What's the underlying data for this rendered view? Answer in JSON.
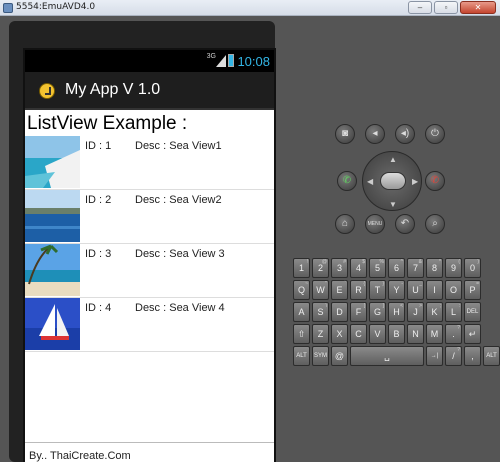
{
  "window": {
    "title": "5554:EmuAVD4.0",
    "buttons": [
      "‒",
      "▫",
      "✕"
    ]
  },
  "status": {
    "network": "3G",
    "time": "10:08"
  },
  "app": {
    "title": "My App V 1.0"
  },
  "list": {
    "header": "ListView Example :",
    "items": [
      {
        "id": "ID : 1",
        "desc": "Desc : Sea View1",
        "image": "sea-view-1"
      },
      {
        "id": "ID : 2",
        "desc": "Desc : Sea View2",
        "image": "sea-view-2"
      },
      {
        "id": "ID : 3",
        "desc": "Desc : Sea View 3",
        "image": "sea-view-3"
      },
      {
        "id": "ID : 4",
        "desc": "Desc : Sea View 4",
        "image": "sea-view-4"
      }
    ]
  },
  "footer": {
    "text": "By.. ThaiCreate.Com"
  },
  "controls": {
    "top_row": [
      "camera-icon",
      "volume-down-icon",
      "volume-up-icon",
      "power-icon"
    ],
    "call_buttons": [
      "call-icon",
      "end-call-icon"
    ],
    "bottom_row": [
      "home-icon",
      "menu-button",
      "back-icon",
      "search-icon"
    ],
    "menu_label": "MENU"
  },
  "keyboard": {
    "row1": [
      "1",
      "2",
      "3",
      "4",
      "5",
      "6",
      "7",
      "8",
      "9",
      "0"
    ],
    "row1_sub": [
      "!",
      "@",
      "#",
      "$",
      "%",
      "^",
      "&",
      "*",
      "(",
      ")"
    ],
    "row2": [
      "Q",
      "W",
      "E",
      "R",
      "T",
      "Y",
      "U",
      "I",
      "O",
      "P"
    ],
    "row2_sub": [
      "~",
      "\"",
      "`",
      "{",
      "}",
      "-",
      "_",
      "",
      "",
      "="
    ],
    "row3": [
      "A",
      "S",
      "D",
      "F",
      "G",
      "H",
      "J",
      "K",
      "L",
      "DEL"
    ],
    "row3_sub": [
      "",
      "\\",
      "",
      "[",
      "]",
      "<",
      ">",
      ";",
      ":",
      ""
    ],
    "row4": [
      "⇧",
      "Z",
      "X",
      "C",
      "V",
      "B",
      "N",
      "M",
      ".",
      "↵"
    ],
    "row4_sub": [
      "",
      "",
      "",
      "",
      "",
      "",
      "",
      "",
      "?",
      ""
    ],
    "row5": [
      "ALT",
      "SYM",
      "@",
      "␣",
      "→|",
      "/",
      ",",
      "ALT"
    ],
    "row5_sub": [
      "",
      "",
      "",
      "",
      "",
      "?",
      "",
      ""
    ]
  },
  "colors": {
    "status_accent": "#33b5e5",
    "actionbar": "#1e1e1e",
    "emulator_bg": "#555555"
  }
}
